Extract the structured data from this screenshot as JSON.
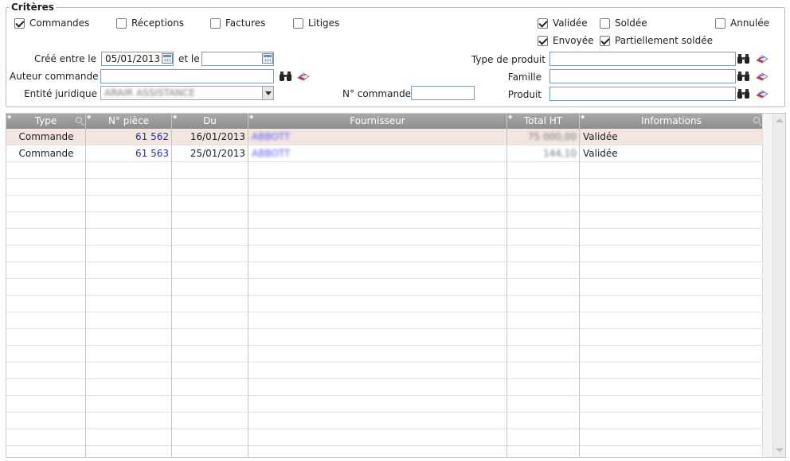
{
  "criteria": {
    "legend": "Critères",
    "doc_types": [
      {
        "label": "Commandes",
        "checked": true
      },
      {
        "label": "Réceptions",
        "checked": false
      },
      {
        "label": "Factures",
        "checked": false
      },
      {
        "label": "Litiges",
        "checked": false
      }
    ],
    "statuses": [
      {
        "label": "Validée",
        "checked": true
      },
      {
        "label": "Soldée",
        "checked": false
      },
      {
        "label": "Annulée",
        "checked": false
      },
      {
        "label": "Envoyée",
        "checked": true
      },
      {
        "label": "Partiellement soldée",
        "checked": true
      }
    ],
    "created_between_label": "Créé entre le",
    "created_from": "05/01/2013",
    "and_label": "et le",
    "created_to": "",
    "author_label": "Auteur commande",
    "author_value": "",
    "entity_label": "Entité juridique",
    "entity_value": "ARAIR ASSISTANCE",
    "order_no_label": "N° commande",
    "order_no_value": "",
    "product_type_label": "Type de produit",
    "product_type_value": "",
    "family_label": "Famille",
    "family_value": "",
    "product_label": "Produit",
    "product_value": ""
  },
  "grid": {
    "columns": [
      "Type",
      "N° pièce",
      "Du",
      "Fournisseur",
      "Total HT",
      "Informations"
    ],
    "rows": [
      {
        "type": "Commande",
        "piece": "61 562",
        "date": "16/01/2013",
        "supplier": "ABBOTT",
        "total": "75 000,00",
        "info": "Validée"
      },
      {
        "type": "Commande",
        "piece": "61 563",
        "date": "25/01/2013",
        "supplier": "ABBOTT",
        "total": "144,10",
        "info": "Validée"
      }
    ]
  },
  "icons": {
    "search": "binoculars-icon",
    "clear": "eraser-icon",
    "calendar": "calendar-icon",
    "filter": "magnifier-icon"
  }
}
